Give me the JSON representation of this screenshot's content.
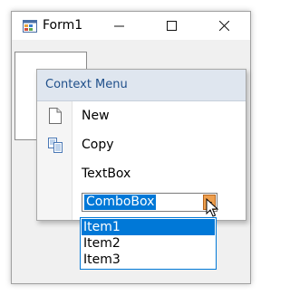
{
  "window": {
    "title": "Form1",
    "icon": "winforms-app-icon",
    "controls": {
      "minimize": "minimize-icon",
      "maximize": "maximize-icon",
      "close": "close-icon"
    }
  },
  "context_menu": {
    "header": "Context Menu",
    "items": [
      {
        "label": "New",
        "icon": "new-document-icon"
      },
      {
        "label": "Copy",
        "icon": "copy-icon"
      },
      {
        "label": "TextBox"
      }
    ],
    "combobox": {
      "value": "ComboBox",
      "button_icon": "dropdown-arrow-icon",
      "options": [
        "Item1",
        "Item2",
        "Item3"
      ],
      "highlighted_option": "Item1"
    }
  },
  "colors": {
    "selection": "#0078d7",
    "menu_header": "#dfe6ef",
    "combo_button": "#ee9f4e"
  }
}
